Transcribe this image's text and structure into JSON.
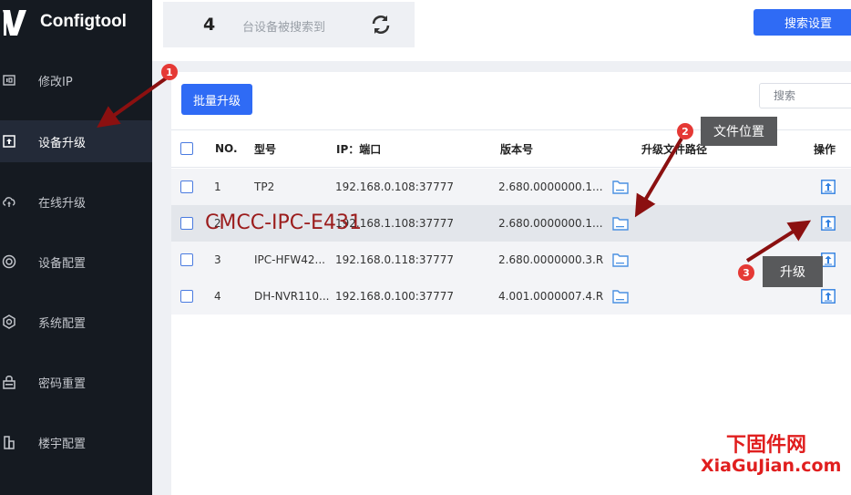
{
  "app": {
    "title": "Configtool"
  },
  "sidebar": {
    "items": [
      {
        "label": "修改IP",
        "icon": "ip-icon"
      },
      {
        "label": "设备升级",
        "icon": "upgrade-icon",
        "active": true
      },
      {
        "label": "在线升级",
        "icon": "cloud-upload-icon"
      },
      {
        "label": "设备配置",
        "icon": "device-config-icon"
      },
      {
        "label": "系统配置",
        "icon": "system-config-icon"
      },
      {
        "label": "密码重置",
        "icon": "password-reset-icon"
      },
      {
        "label": "楼宇配置",
        "icon": "building-config-icon"
      }
    ]
  },
  "header": {
    "device_count": "4",
    "device_count_text": "台设备被搜索到",
    "search_settings_label": "搜索设置"
  },
  "toolbar": {
    "batch_upgrade_label": "批量升级",
    "search_placeholder": "搜索"
  },
  "table": {
    "columns": [
      "NO.",
      "型号",
      "IP：端口",
      "版本号",
      "升级文件路径",
      "操作"
    ],
    "rows": [
      {
        "no": "1",
        "model": "TP2",
        "ip_port": "192.168.0.108:37777",
        "version": "2.680.0000000.1..."
      },
      {
        "no": "2",
        "model": "",
        "ip_port": "192.168.1.108:37777",
        "version": "2.680.0000000.1..."
      },
      {
        "no": "3",
        "model": "IPC-HFW42...",
        "ip_port": "192.168.0.118:37777",
        "version": "2.680.0000000.3.R"
      },
      {
        "no": "4",
        "model": "DH-NVR110...",
        "ip_port": "192.168.0.100:37777",
        "version": "4.001.0000007.4.R"
      }
    ]
  },
  "annotations": {
    "badges": [
      "1",
      "2",
      "3"
    ],
    "tip_file_location": "文件位置",
    "tip_upgrade": "升级",
    "overlay_model": "CMCC-IPC-E431",
    "arrow_color": "#8b1010"
  },
  "watermark": {
    "line1": "下固件网",
    "line2": "XiaGuJian.com"
  },
  "colors": {
    "accent": "#2f6bf5",
    "sidebar": "#151a21",
    "annotation_red": "#e53935"
  }
}
